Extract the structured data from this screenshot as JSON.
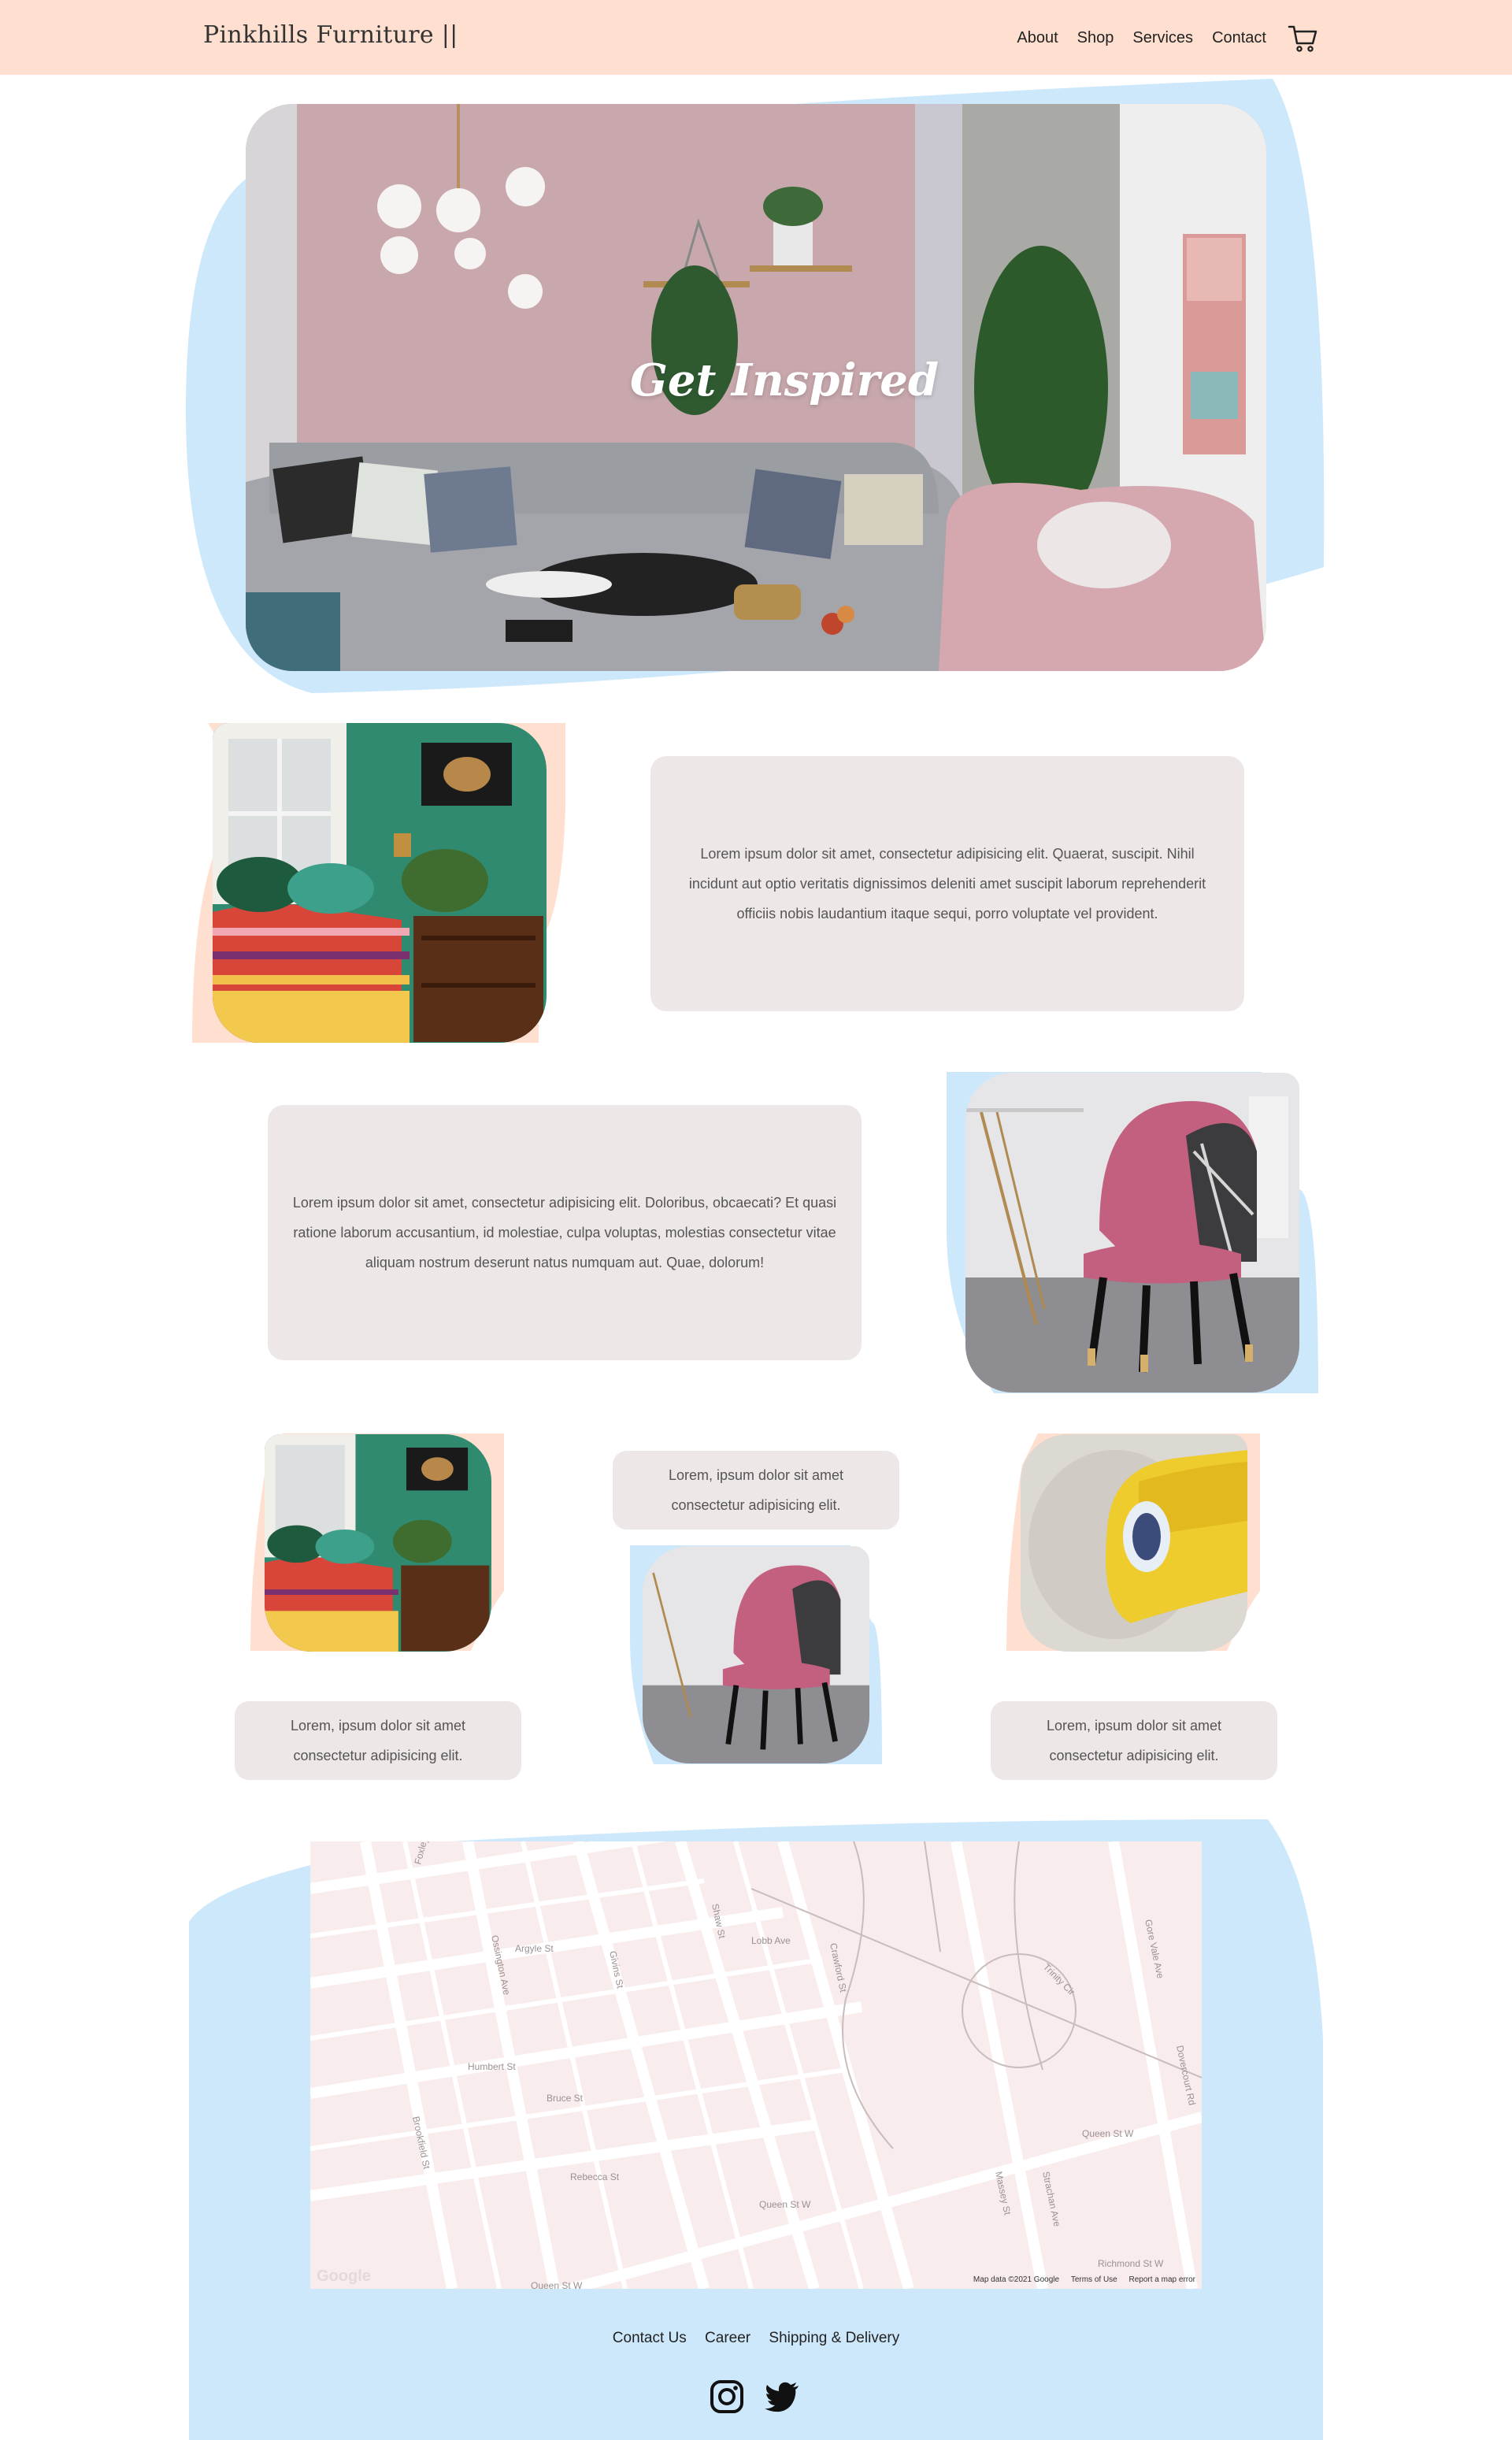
{
  "header": {
    "brand": "Pinkhills Furniture ||",
    "nav": [
      "About",
      "Shop",
      "Services",
      "Contact"
    ],
    "cart_icon": "shopping-cart-icon"
  },
  "hero": {
    "title": "Get Inspired"
  },
  "features": {
    "text1": "Lorem ipsum dolor sit amet, consectetur adipisicing elit. Quaerat, suscipit. Nihil incidunt aut optio veritatis dignissimos deleniti amet suscipit laborum reprehenderit officiis nobis laudantium itaque sequi, porro voluptate vel provident.",
    "text2": "Lorem ipsum dolor sit amet, consectetur adipisicing elit. Doloribus, obcaecati? Et quasi ratione laborum accusantium, id molestiae, culpa voluptas, molestias consectetur vitae aliquam nostrum deserunt natus numquam aut. Quae, dolorum!"
  },
  "gallery": {
    "left_caption": "Lorem, ipsum dolor sit amet consectetur adipisicing elit.",
    "center_caption": "Lorem, ipsum dolor sit amet consectetur adipisicing elit.",
    "right_caption": "Lorem, ipsum dolor sit amet consectetur adipisicing elit."
  },
  "map": {
    "streets": [
      "Foxley St",
      "Argyle St",
      "Ossington Ave",
      "Givins St",
      "Shaw St",
      "Crawford St",
      "Lobb Ave",
      "Gore Vale Ave",
      "Humbert St",
      "Bruce St",
      "Rebecca St",
      "Brookfield St",
      "Queen St W",
      "Strachan Ave",
      "Massey St",
      "Richmond St W",
      "Trinity Cir",
      "Dovercourt Rd"
    ],
    "attribution": [
      "Map data ©2021 Google",
      "Terms of Use",
      "Report a map error"
    ],
    "logo": "Google"
  },
  "footer": {
    "links": [
      "Contact Us",
      "Career",
      "Shipping & Delivery"
    ],
    "icons": [
      "instagram-icon",
      "twitter-icon"
    ]
  },
  "colors": {
    "navbar": "#ffdfcf",
    "blue_accent": "#cde8fb",
    "peach_accent": "#ffdfcf",
    "card_bg": "#eee7e7"
  }
}
